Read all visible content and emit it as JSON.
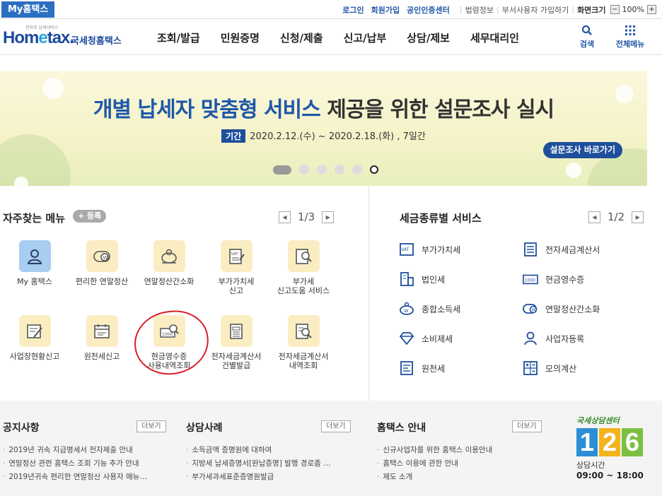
{
  "topbar": {
    "my_tab": "My홈택스",
    "links": [
      "로그인",
      "회원가입",
      "공인인증센터"
    ],
    "util_links": [
      "법령정보",
      "부서사용자 가입하기"
    ],
    "zoom_label": "화면크기",
    "zoom_minus": "−",
    "zoom_value": "100%",
    "zoom_plus": "+"
  },
  "header": {
    "logo_small": "전자로 납세서비스",
    "logo_home": "Hom",
    "logo_e": "e",
    "logo_tax": "tax.",
    "logo_kr": "국세청홈택스",
    "nav": [
      "조회/발급",
      "민원증명",
      "신청/제출",
      "신고/납부",
      "상담/제보",
      "세무대리인"
    ],
    "search_label": "검색",
    "allmenu_label": "전체메뉴"
  },
  "banner": {
    "title_highlight": "개별 납세자 맞춤형 서비스",
    "title_rest": " 제공을 위한 설문조사 실시",
    "period_tag": "기간",
    "period": "2020.2.12.(수) ~ 2020.2.18.(화) , 7일간",
    "button": "설문조사 바로가기",
    "slide_count": 5,
    "active_slide": 1
  },
  "frequent": {
    "title": "자주찾는 메뉴",
    "register": "+ 등록",
    "page": "1/3",
    "items": [
      {
        "label": "My 홈택스",
        "icon": "user-icon"
      },
      {
        "label": "편리한 연말정산",
        "icon": "coin-w-icon"
      },
      {
        "label": "연말정산간소화",
        "icon": "piggybank-icon"
      },
      {
        "label": "부가가치세\n신고",
        "icon": "vat-doc-icon"
      },
      {
        "label": "부가세\n신고도움 서비스",
        "icon": "doc-search-icon"
      },
      {
        "label": "사업장현황신고",
        "icon": "edit-doc-icon"
      },
      {
        "label": "원천세신고",
        "icon": "calendar-icon"
      },
      {
        "label": "현금영수증\n사용내역조회",
        "icon": "receipt-search-icon"
      },
      {
        "label": "전자세금계산서\n건별발급",
        "icon": "invoice-icon"
      },
      {
        "label": "전자세금계산서\n내역조회",
        "icon": "invoice-search-icon"
      }
    ]
  },
  "tax_services": {
    "title": "세금종류별 서비스",
    "page": "1/2",
    "items": [
      {
        "label": "부가가치세",
        "icon": "vat-icon"
      },
      {
        "label": "전자세금계산서",
        "icon": "tax-invoice-icon"
      },
      {
        "label": "법인세",
        "icon": "building-icon"
      },
      {
        "label": "현금영수증",
        "icon": "cash-receipt-icon"
      },
      {
        "label": "종합소득세",
        "icon": "piggybank-icon"
      },
      {
        "label": "연말정산간소화",
        "icon": "coin-w-icon"
      },
      {
        "label": "소비제세",
        "icon": "diamond-icon"
      },
      {
        "label": "사업자등록",
        "icon": "person-icon"
      },
      {
        "label": "원천세",
        "icon": "doc-icon"
      },
      {
        "label": "모의계산",
        "icon": "calculator-icon"
      }
    ]
  },
  "notices": {
    "title": "공지사항",
    "more": "더보기",
    "items": [
      "2019년 귀속 지급명세서 전자제출 안내",
      "연말정산 관련 홈택스 조회 기능 추가 안내",
      "2019년귀속 편리한 연말정산 사용자 매뉴…"
    ]
  },
  "consult": {
    "title": "상담사례",
    "more": "더보기",
    "items": [
      "소득금액 증명원에 대하여",
      "지방세 납세증명서[완납증명] 발행 경로좀 …",
      "부가세과세표준증명원발급"
    ]
  },
  "guide": {
    "title": "홈택스 안내",
    "more": "더보기",
    "items": [
      "신규사업자를 위한 홈택스 이용안내",
      "홈택스 이용에 관한 안내",
      "제도 소개"
    ]
  },
  "call_center": {
    "name": "국세상담센터",
    "digits": [
      "1",
      "2",
      "6"
    ],
    "colors": [
      "#2a8fd6",
      "#f2b31c",
      "#7cc042"
    ],
    "hours_label": "상담시간",
    "hours": "09:00 ~ 18:00"
  }
}
